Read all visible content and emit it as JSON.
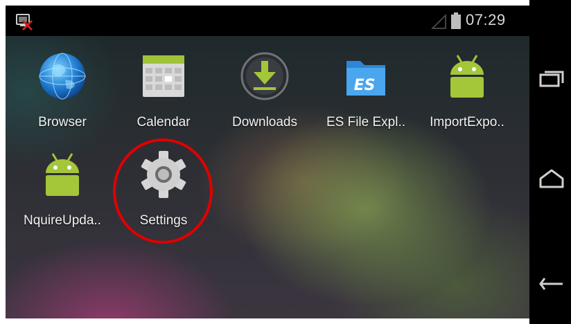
{
  "status_bar": {
    "time": "07:29",
    "notification_icon": "usb-debug-notification-icon",
    "signal_icon": "signal-icon",
    "battery_icon": "battery-icon"
  },
  "apps": [
    {
      "label": "Browser",
      "icon": "browser-globe-icon"
    },
    {
      "label": "Calendar",
      "icon": "calendar-icon"
    },
    {
      "label": "Downloads",
      "icon": "download-icon"
    },
    {
      "label": "ES File Expl..",
      "icon": "es-file-explorer-icon"
    },
    {
      "label": "ImportExpo..",
      "icon": "android-icon"
    },
    {
      "label": "NquireUpda..",
      "icon": "android-icon"
    },
    {
      "label": "Settings",
      "icon": "settings-gear-icon"
    }
  ],
  "highlight": {
    "target": "Settings",
    "color": "#e00000"
  },
  "nav_bar": {
    "buttons": [
      "recent-apps-icon",
      "home-icon",
      "back-icon"
    ]
  },
  "colors": {
    "android_green": "#a4c639",
    "status_bar_bg": "#000000",
    "label_text": "#f2f2f2"
  }
}
